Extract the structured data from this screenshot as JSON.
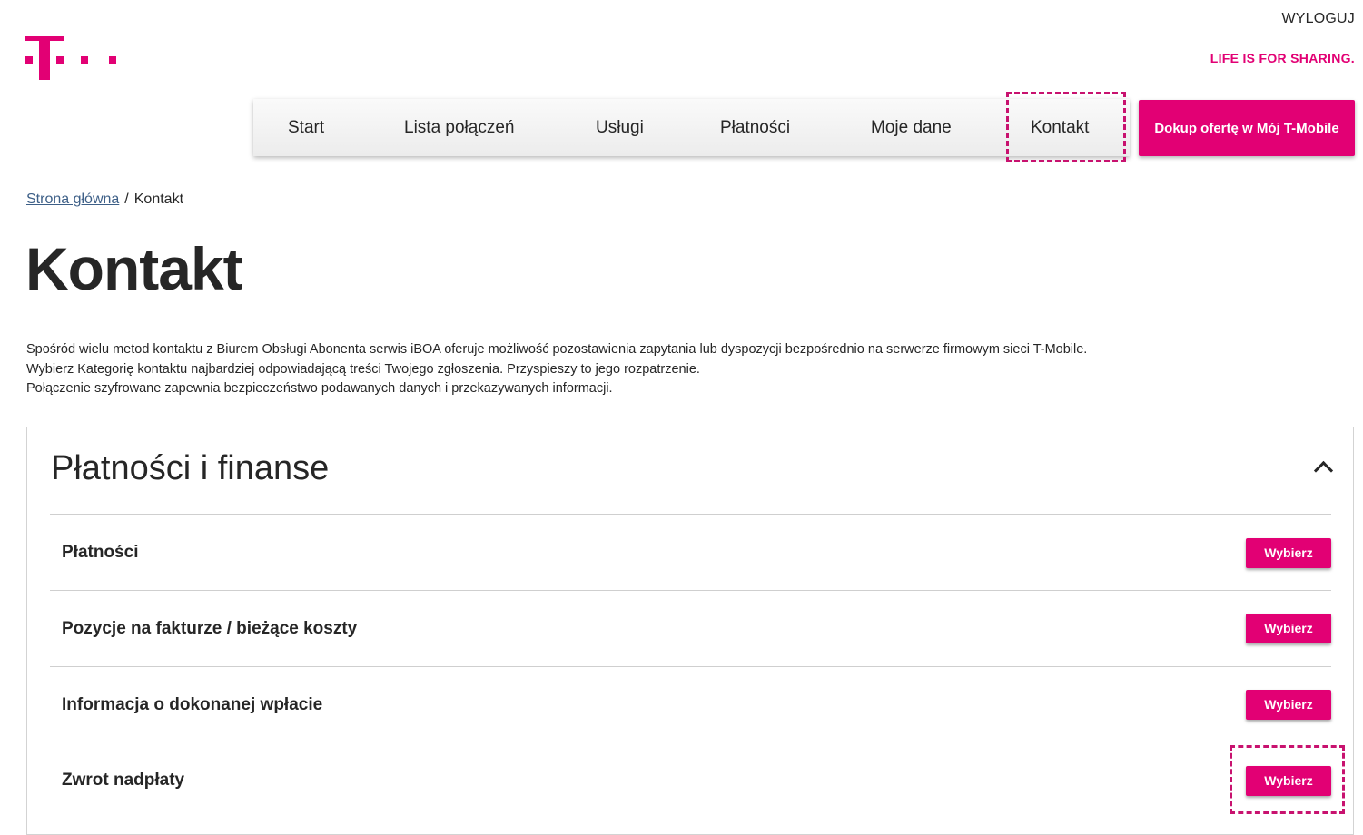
{
  "header": {
    "logo_alt": "T-Mobile logo",
    "logout_label": "WYLOGUJ",
    "slogan": "LIFE IS FOR SHARING."
  },
  "nav": {
    "items": [
      {
        "label": "Start"
      },
      {
        "label": "Lista połączeń"
      },
      {
        "label": "Usługi"
      },
      {
        "label": "Płatności"
      },
      {
        "label": "Moje dane"
      },
      {
        "label": "Kontakt"
      }
    ],
    "cta_label": "Dokup ofertę w Mój T-Mobile"
  },
  "breadcrumb": {
    "home_label": "Strona główna",
    "separator": "/",
    "current": "Kontakt"
  },
  "page": {
    "title": "Kontakt",
    "intro": [
      "Spośród wielu metod kontaktu z Biurem Obsługi Abonenta serwis iBOA oferuje możliwość pozostawienia zapytania lub dyspozycji bezpośrednio na serwerze firmowym sieci T-Mobile.",
      "Wybierz Kategorię kontaktu najbardziej odpowiadającą treści Twojego zgłoszenia. Przyspieszy to jego rozpatrzenie.",
      "Połączenie szyfrowane zapewnia bezpieczeństwo podawanych danych i przekazywanych informacji."
    ]
  },
  "section": {
    "title": "Płatności i finanse",
    "rows": [
      {
        "label": "Płatności",
        "button": "Wybierz"
      },
      {
        "label": "Pozycje na fakturze / bieżące koszty",
        "button": "Wybierz"
      },
      {
        "label": "Informacja o dokonanej wpłacie",
        "button": "Wybierz"
      },
      {
        "label": "Zwrot nadpłaty",
        "button": "Wybierz"
      }
    ]
  },
  "colors": {
    "brand": "#e20074",
    "highlight": "#c8126f",
    "text": "#262626",
    "link": "#3d5f87"
  }
}
